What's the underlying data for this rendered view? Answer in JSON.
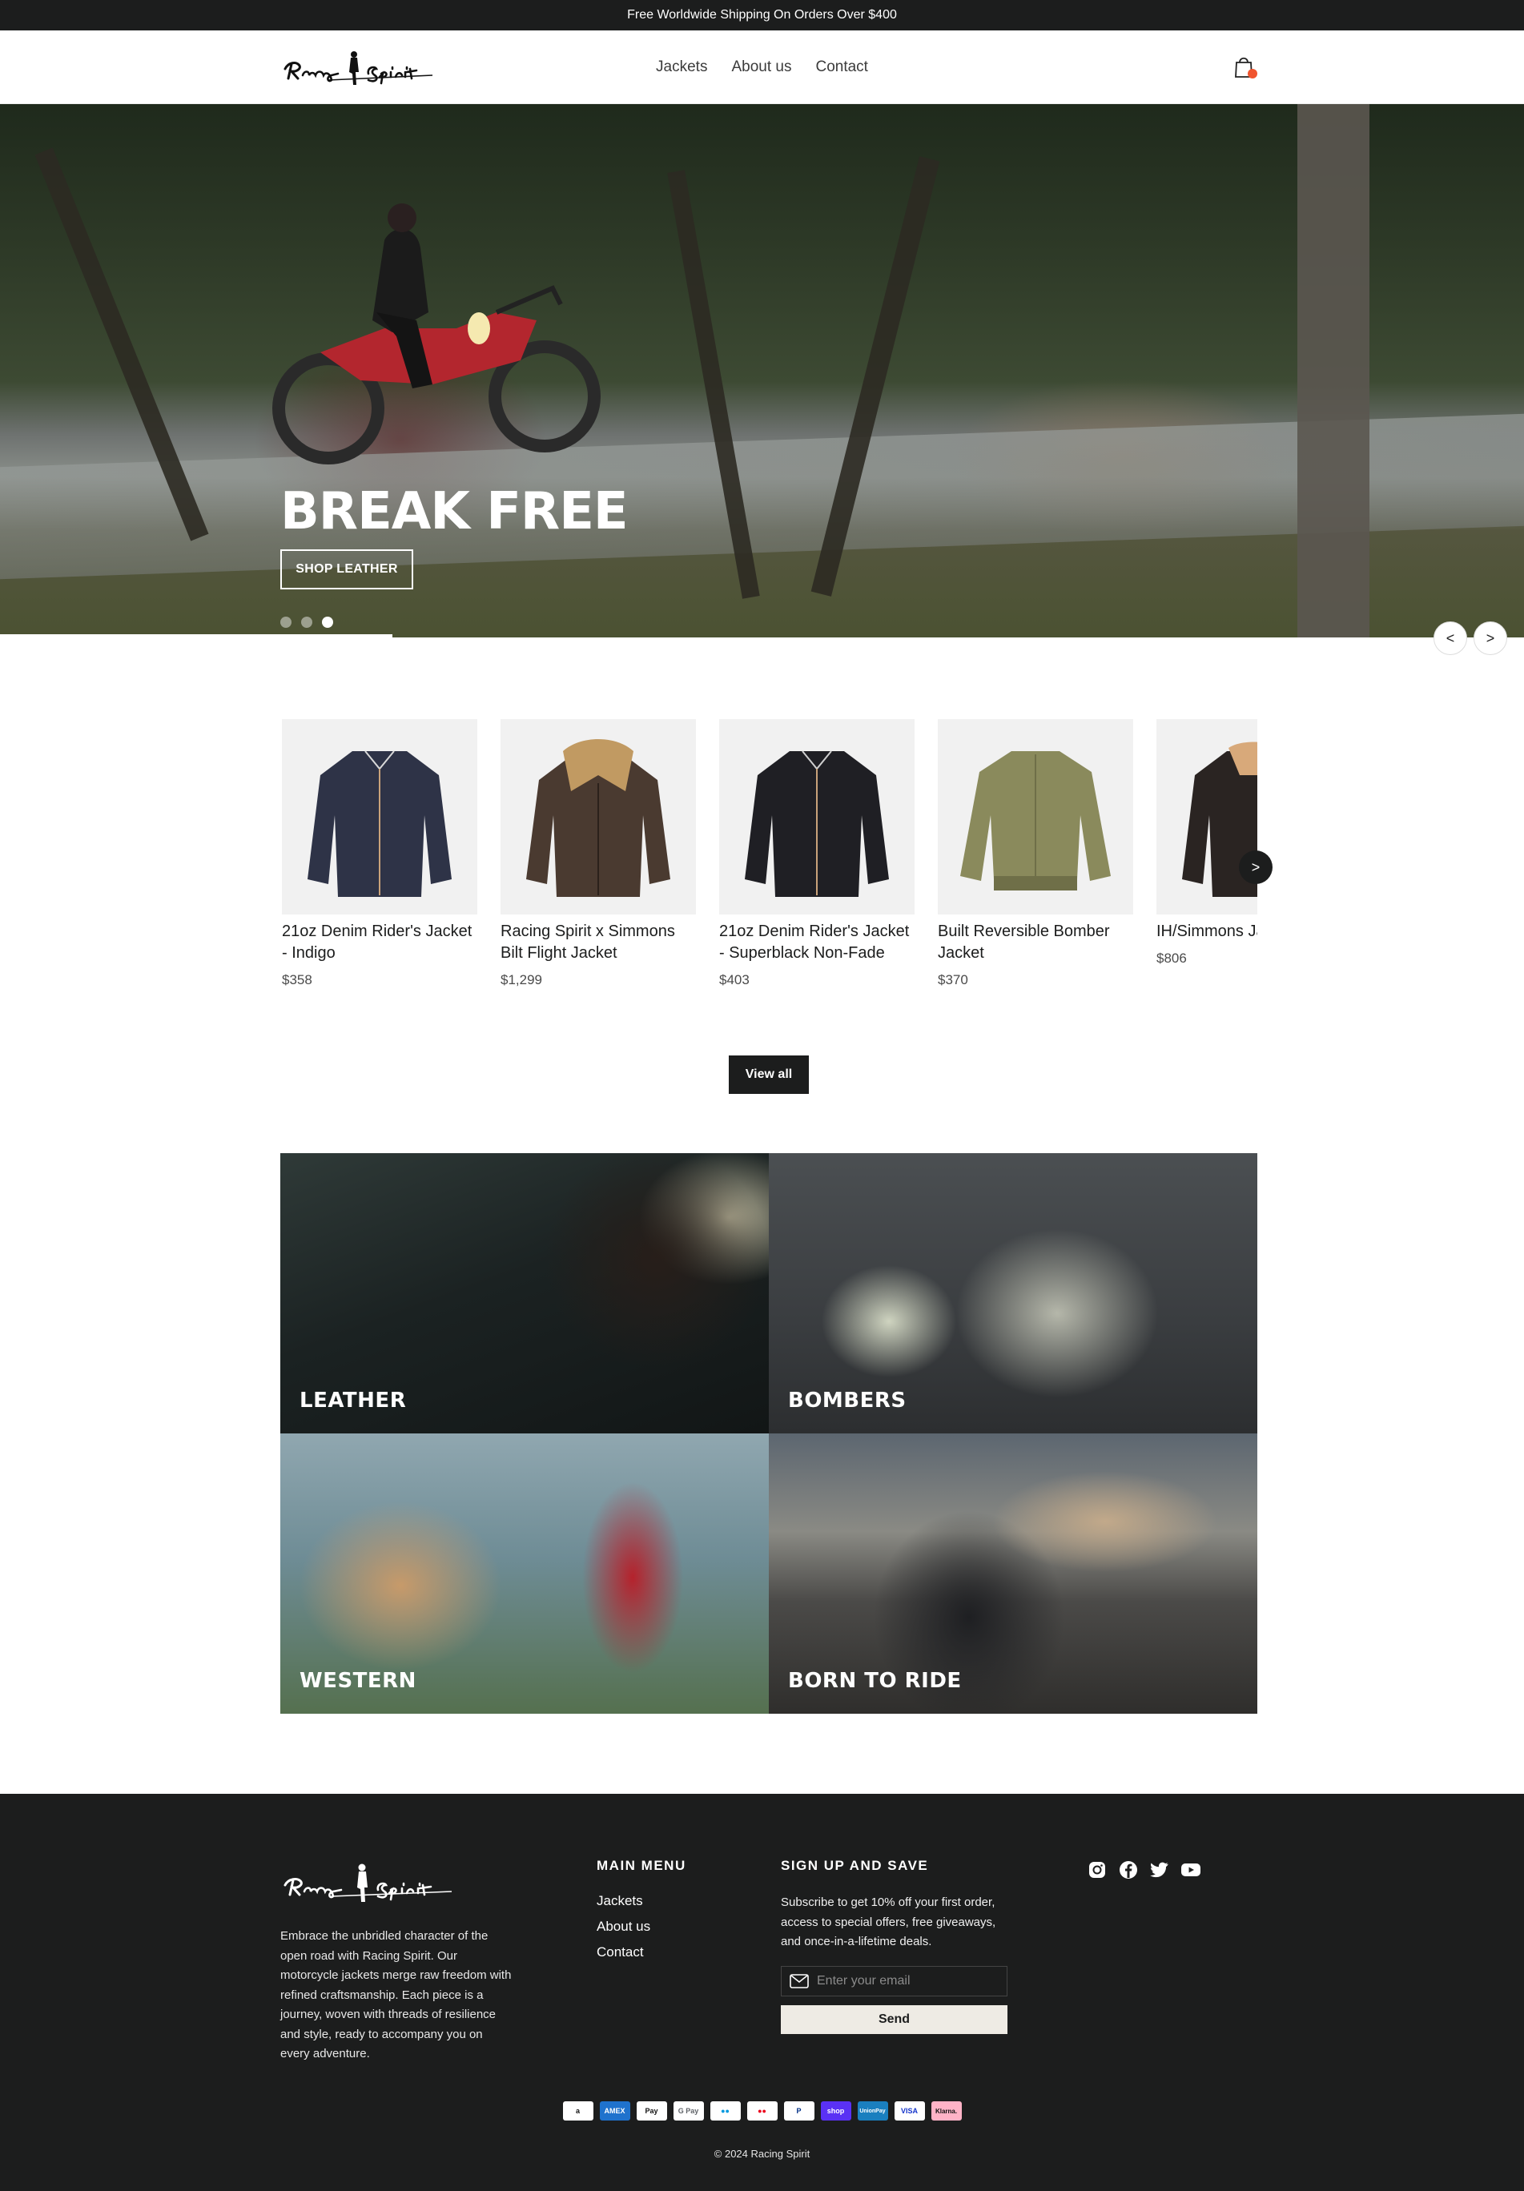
{
  "announcement": "Free Worldwide Shipping On Orders Over $400",
  "brand": "Racing Spirit",
  "nav": {
    "items": [
      "Jackets",
      "About us",
      "Contact"
    ]
  },
  "cart": {
    "icon": "shopping-bag-icon",
    "badge_color": "#f0542e"
  },
  "hero": {
    "title": "BREAK FREE",
    "button": "SHOP LEATHER",
    "slides_total": 3,
    "active_slide": 3,
    "prev_label": "<",
    "next_label": ">"
  },
  "products": [
    {
      "name": "21oz Denim Rider's Jacket - Indigo",
      "price": "$358",
      "color": "#2e3347"
    },
    {
      "name": "Racing Spirit x Simmons Bilt Flight Jacket",
      "price": "$1,299",
      "color": "#4a3a30"
    },
    {
      "name": "21oz Denim Rider's Jacket - Superblack Non-Fade",
      "price": "$403",
      "color": "#1f1f24"
    },
    {
      "name": "Built Reversible Bomber Jacket",
      "price": "$370",
      "color": "#8a8a5c"
    },
    {
      "name": "IH/Simmons Jacket",
      "price": "$806",
      "color": "#2a2422"
    }
  ],
  "products_next_label": ">",
  "view_all": "View all",
  "collections": [
    {
      "label": "LEATHER"
    },
    {
      "label": "BOMBERS"
    },
    {
      "label": "WESTERN"
    },
    {
      "label": "BORN TO RIDE"
    }
  ],
  "footer": {
    "about": "Embrace the unbridled character of the open road with Racing Spirit. Our motorcycle jackets merge raw freedom with refined craftsmanship. Each piece is a journey, woven with threads of resilience and style, ready to accompany you on every adventure.",
    "menu_title": "MAIN MENU",
    "menu": [
      "Jackets",
      "About us",
      "Contact"
    ],
    "signup_title": "SIGN UP AND SAVE",
    "signup_text": "Subscribe to get 10% off your first order, access to special offers, free giveaways, and once-in-a-lifetime deals.",
    "email_placeholder": "Enter your email",
    "send": "Send",
    "socials": [
      "instagram-icon",
      "facebook-icon",
      "twitter-icon",
      "youtube-icon"
    ],
    "payments": [
      {
        "label": "a",
        "bg": "#ffffff",
        "fg": "#111111"
      },
      {
        "label": "AMEX",
        "bg": "#1f72cd",
        "fg": "#ffffff"
      },
      {
        "label": "Pay",
        "bg": "#ffffff",
        "fg": "#111111"
      },
      {
        "label": "G Pay",
        "bg": "#ffffff",
        "fg": "#5f6368"
      },
      {
        "label": "●●",
        "bg": "#ffffff",
        "fg": "#0099df"
      },
      {
        "label": "●●",
        "bg": "#ffffff",
        "fg": "#eb001b"
      },
      {
        "label": "P",
        "bg": "#ffffff",
        "fg": "#003087"
      },
      {
        "label": "shop",
        "bg": "#5a31f4",
        "fg": "#ffffff"
      },
      {
        "label": "UnionPay",
        "bg": "#1a7fbf",
        "fg": "#ffffff"
      },
      {
        "label": "VISA",
        "bg": "#ffffff",
        "fg": "#1434cb"
      },
      {
        "label": "Klarna.",
        "bg": "#ffb3c7",
        "fg": "#111111"
      }
    ],
    "copyright": "© 2024 Racing Spirit"
  }
}
